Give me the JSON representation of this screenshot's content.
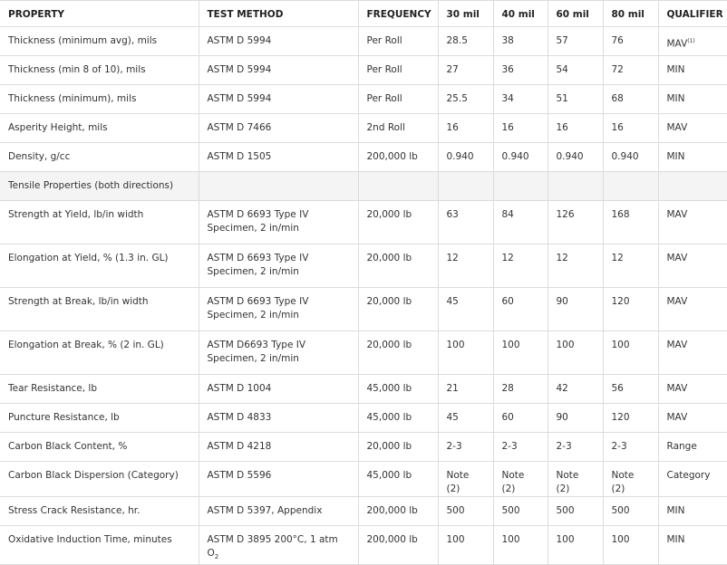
{
  "headers": [
    "PROPERTY",
    "TEST METHOD",
    "FREQUENCY",
    "30 mil",
    "40 mil",
    "60 mil",
    "80 mil",
    "QUALIFIER"
  ],
  "rows": [
    {
      "property": "Thickness (minimum avg), mils",
      "method": "ASTM D 5994",
      "frequency": "Per Roll",
      "v30": "28.5",
      "v40": "38",
      "v60": "57",
      "v80": "76",
      "qualifier": "MAV",
      "qualifier_note": "(1)"
    },
    {
      "property": "Thickness (min 8 of 10), mils",
      "method": "ASTM D 5994",
      "frequency": "Per Roll",
      "v30": "27",
      "v40": "36",
      "v60": "54",
      "v80": "72",
      "qualifier": "MIN"
    },
    {
      "property": "Thickness (minimum), mils",
      "method": "ASTM D 5994",
      "frequency": "Per Roll",
      "v30": "25.5",
      "v40": "34",
      "v60": "51",
      "v80": "68",
      "qualifier": "MIN"
    },
    {
      "property": "Asperity Height, mils",
      "method": "ASTM D 7466",
      "frequency": "2nd Roll",
      "v30": "16",
      "v40": "16",
      "v60": "16",
      "v80": "16",
      "qualifier": "MAV"
    },
    {
      "property": "Density, g/cc",
      "method": "ASTM D 1505",
      "frequency": "200,000 lb",
      "v30": "0.940",
      "v40": "0.940",
      "v60": "0.940",
      "v80": "0.940",
      "qualifier": "MIN"
    },
    {
      "section": true,
      "property": "Tensile Properties (both directions)"
    },
    {
      "tall": true,
      "property": "Strength at Yield, lb/in width",
      "method": "ASTM D 6693 Type IV Specimen, 2 in/min",
      "frequency": "20,000 lb",
      "v30": "63",
      "v40": "84",
      "v60": "126",
      "v80": "168",
      "qualifier": "MAV"
    },
    {
      "tall": true,
      "property": "Elongation at Yield, % (1.3 in. GL)",
      "method": "ASTM D 6693 Type IV Specimen, 2 in/min",
      "frequency": "20,000 lb",
      "v30": "12",
      "v40": "12",
      "v60": "12",
      "v80": "12",
      "qualifier": "MAV"
    },
    {
      "tall": true,
      "property": "Strength at Break, lb/in width",
      "method": "ASTM D 6693 Type IV Specimen, 2 in/min",
      "frequency": "20,000 lb",
      "v30": "45",
      "v40": "60",
      "v60": "90",
      "v80": "120",
      "qualifier": "MAV"
    },
    {
      "tall": true,
      "property": "Elongation at Break, % (2 in. GL)",
      "method": "ASTM D6693 Type IV Specimen, 2 in/min",
      "frequency": "20,000 lb",
      "v30": "100",
      "v40": "100",
      "v60": "100",
      "v80": "100",
      "qualifier": "MAV"
    },
    {
      "property": "Tear Resistance, lb",
      "method": "ASTM D 1004",
      "frequency": "45,000 lb",
      "v30": "21",
      "v40": "28",
      "v60": "42",
      "v80": "56",
      "qualifier": "MAV"
    },
    {
      "property": "Puncture Resistance, lb",
      "method": "ASTM D 4833",
      "frequency": "45,000 lb",
      "v30": "45",
      "v40": "60",
      "v60": "90",
      "v80": "120",
      "qualifier": "MAV"
    },
    {
      "property": "Carbon Black Content, %",
      "method": "ASTM D 4218",
      "frequency": "20,000 lb",
      "v30": "2-3",
      "v40": "2-3",
      "v60": "2-3",
      "v80": "2-3",
      "qualifier": "Range"
    },
    {
      "property": "Carbon Black Dispersion (Category)",
      "method": "ASTM D 5596",
      "frequency": "45,000 lb",
      "v30": "Note (2)",
      "v40": "Note (2)",
      "v60": "Note (2)",
      "v80": "Note (2)",
      "qualifier": "Category"
    },
    {
      "property": "Stress Crack Resistance, hr.",
      "method": "ASTM D 5397, Appendix",
      "frequency": "200,000 lb",
      "v30": "500",
      "v40": "500",
      "v60": "500",
      "v80": "500",
      "qualifier": "MIN"
    },
    {
      "property": "Oxidative Induction Time, minutes",
      "method": "ASTM D 3895 200°C, 1 atm O",
      "method_sub": "2",
      "frequency": "200,000 lb",
      "v30": "100",
      "v40": "100",
      "v60": "100",
      "v80": "100",
      "qualifier": "MIN"
    }
  ]
}
